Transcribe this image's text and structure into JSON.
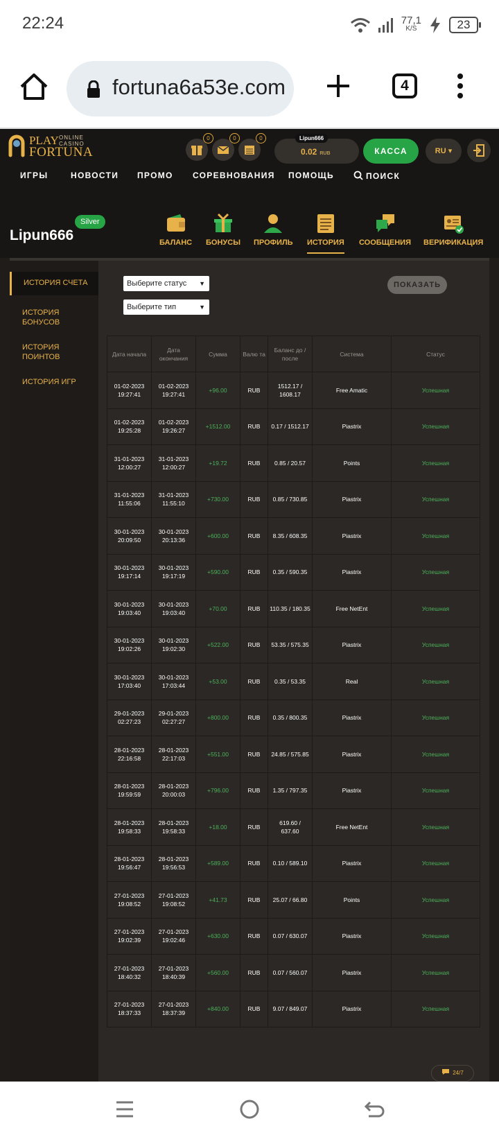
{
  "status_bar": {
    "time": "22:24",
    "net_speed_value": "77,1",
    "net_speed_unit": "K/S",
    "battery": "23"
  },
  "browser": {
    "url": "fortuna6a53e.com",
    "tab_count": "4"
  },
  "site": {
    "logo_play": "PLAY",
    "logo_online": "ONLINE",
    "logo_casino": "CASINO",
    "logo_fortuna": "FORTUNA",
    "badges": [
      "0",
      "0",
      "0"
    ],
    "balance_user": "Lipun666",
    "balance_amount": "0.02",
    "balance_currency": "RUB",
    "kassa_label": "КАССА",
    "lang_label": "RU ▾",
    "nav": [
      "ИГРЫ",
      "НОВОСТИ",
      "ПРОМО",
      "СОРЕВНОВАНИЯ",
      "ПОМОЩЬ",
      "ПОИСК"
    ]
  },
  "profile": {
    "username": "Lipun666",
    "level": "Silver",
    "tabs": [
      "БАЛАНС",
      "БОНУСЫ",
      "ПРОФИЛЬ",
      "ИСТОРИЯ",
      "СООБЩЕНИЯ",
      "ВЕРИФИКАЦИЯ"
    ]
  },
  "sidebar": {
    "items": [
      "ИСТОРИЯ СЧЕТА",
      "ИСТОРИЯ БОНУСОВ",
      "ИСТОРИЯ ПОИНТОВ",
      "ИСТОРИЯ ИГР"
    ]
  },
  "filters": {
    "status_placeholder": "Выберите статус",
    "type_placeholder": "Выберите тип",
    "show_label": "ПОКАЗАТЬ"
  },
  "table": {
    "headers": [
      "Дата начала",
      "Дата окончания",
      "Сумма",
      "Валю та",
      "Баланс до / после",
      "Система",
      "Статус"
    ],
    "rows": [
      [
        "01-02-2023 19:27:41",
        "01-02-2023 19:27:41",
        "+96.00",
        "RUB",
        "1512.17 / 1608.17",
        "Free Amatic",
        "Успешная"
      ],
      [
        "01-02-2023 19:25:28",
        "01-02-2023 19:26:27",
        "+1512.00",
        "RUB",
        "0.17 / 1512.17",
        "Piastrix",
        "Успешная"
      ],
      [
        "31-01-2023 12:00:27",
        "31-01-2023 12:00:27",
        "+19.72",
        "RUB",
        "0.85 / 20.57",
        "Points",
        "Успешная"
      ],
      [
        "31-01-2023 11:55:06",
        "31-01-2023 11:55:10",
        "+730.00",
        "RUB",
        "0.85 / 730.85",
        "Piastrix",
        "Успешная"
      ],
      [
        "30-01-2023 20:09:50",
        "30-01-2023 20:13:36",
        "+600.00",
        "RUB",
        "8.35 / 608.35",
        "Piastrix",
        "Успешная"
      ],
      [
        "30-01-2023 19:17:14",
        "30-01-2023 19:17:19",
        "+590.00",
        "RUB",
        "0.35 / 590.35",
        "Piastrix",
        "Успешная"
      ],
      [
        "30-01-2023 19:03:40",
        "30-01-2023 19:03:40",
        "+70.00",
        "RUB",
        "110.35 / 180.35",
        "Free NetEnt",
        "Успешная"
      ],
      [
        "30-01-2023 19:02:26",
        "30-01-2023 19:02:30",
        "+522.00",
        "RUB",
        "53.35 / 575.35",
        "Piastrix",
        "Успешная"
      ],
      [
        "30-01-2023 17:03:40",
        "30-01-2023 17:03:44",
        "+53.00",
        "RUB",
        "0.35 / 53.35",
        "Real",
        "Успешная"
      ],
      [
        "29-01-2023 02:27:23",
        "29-01-2023 02:27:27",
        "+800.00",
        "RUB",
        "0.35 / 800.35",
        "Piastrix",
        "Успешная"
      ],
      [
        "28-01-2023 22:16:58",
        "28-01-2023 22:17:03",
        "+551.00",
        "RUB",
        "24.85 / 575.85",
        "Piastrix",
        "Успешная"
      ],
      [
        "28-01-2023 19:59:59",
        "28-01-2023 20:00:03",
        "+796.00",
        "RUB",
        "1.35 / 797.35",
        "Piastrix",
        "Успешная"
      ],
      [
        "28-01-2023 19:58:33",
        "28-01-2023 19:58:33",
        "+18.00",
        "RUB",
        "619.60 / 637.60",
        "Free NetEnt",
        "Успешная"
      ],
      [
        "28-01-2023 19:56:47",
        "28-01-2023 19:56:53",
        "+589.00",
        "RUB",
        "0.10 / 589.10",
        "Piastrix",
        "Успешная"
      ],
      [
        "27-01-2023 19:08:52",
        "27-01-2023 19:08:52",
        "+41.73",
        "RUB",
        "25.07 / 66.80",
        "Points",
        "Успешная"
      ],
      [
        "27-01-2023 19:02:39",
        "27-01-2023 19:02:46",
        "+630.00",
        "RUB",
        "0.07 / 630.07",
        "Piastrix",
        "Успешная"
      ],
      [
        "27-01-2023 18:40:32",
        "27-01-2023 18:40:39",
        "+560.00",
        "RUB",
        "0.07 / 560.07",
        "Piastrix",
        "Успешная"
      ],
      [
        "27-01-2023 18:37:33",
        "27-01-2023 18:37:39",
        "+840.00",
        "RUB",
        "9.07 / 849.07",
        "Piastrix",
        "Успешная"
      ]
    ]
  },
  "chat": {
    "label": "24/7"
  },
  "colors": {
    "accent": "#e8b24a",
    "success": "#4cb25a",
    "kassa": "#27a446",
    "bg": "#1f1c1a"
  }
}
